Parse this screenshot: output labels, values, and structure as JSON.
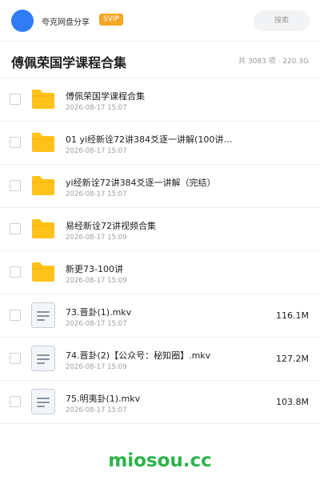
{
  "header": {
    "owner_name": "夸克网盘分享",
    "badge": "SVIP",
    "search_placeholder": "搜索"
  },
  "title_bar": {
    "title": "傅佩荣国学课程合集",
    "summary": "共 3083 项 · 220.3G"
  },
  "files": [
    {
      "type": "folder",
      "name": "傅佩荣国学课程合集",
      "date": "2026-08-17 15:07",
      "size": ""
    },
    {
      "type": "folder",
      "name": "01  yi经新诠72讲384爻逐一讲解(100讲…",
      "date": "2026-08-17 15:07",
      "size": ""
    },
    {
      "type": "folder",
      "name": "yi经新诠72讲384爻逐一讲解（完结）",
      "date": "2026-08-17 15:07",
      "size": ""
    },
    {
      "type": "folder",
      "name": "易经新诠72讲视频合集",
      "date": "2026-08-17 15:09",
      "size": ""
    },
    {
      "type": "folder",
      "name": "新更73-100讲",
      "date": "2026-08-17 15:09",
      "size": ""
    },
    {
      "type": "file",
      "name": "73.晋卦(1).mkv",
      "date": "2026-08-17 15:07",
      "size": "116.1M"
    },
    {
      "type": "file",
      "name": "74.晋卦(2)【公众号：秘知圈】.mkv",
      "date": "2026-08-17 15:09",
      "size": "127.2M"
    },
    {
      "type": "file",
      "name": "75.明夷卦(1).mkv",
      "date": "2026-08-17 15:07",
      "size": "103.8M"
    }
  ],
  "icons": {
    "folder": "folder-icon",
    "file": "document-icon"
  },
  "colors": {
    "avatar": "#2f7cf6",
    "badge": "#f5a623",
    "folder": "#ffc21a",
    "watermark": "#2cb34a"
  },
  "watermark": "miosou.cc"
}
